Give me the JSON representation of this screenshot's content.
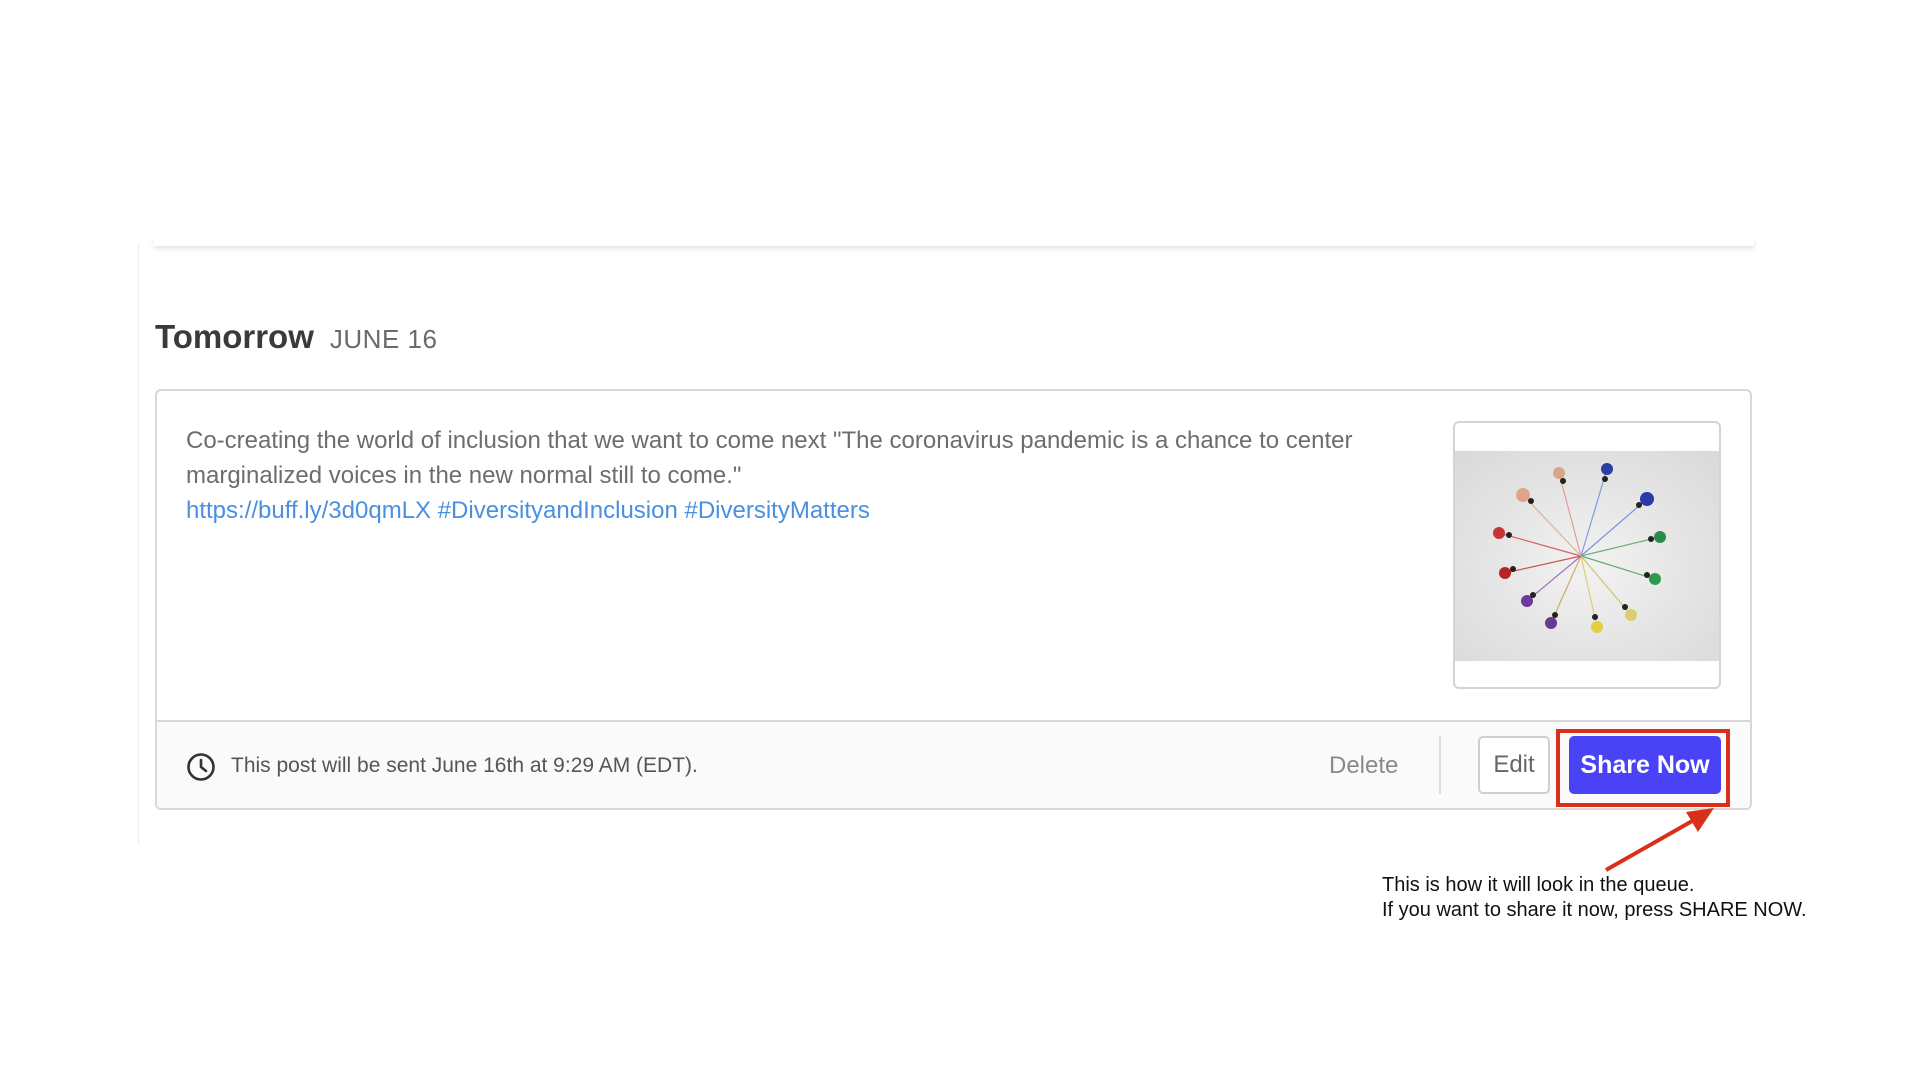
{
  "section": {
    "day_title": "Tomorrow",
    "day_date": "JUNE 16"
  },
  "post": {
    "text": "Co-creating the world of inclusion that we want to come next \"The coronavirus pandemic is a chance to center marginalized voices in the new normal still to come.\"",
    "link": "https://buff.ly/3d0qmLX #DiversityandInclusion #DiversityMatters",
    "image_icon": "people-circle-image",
    "schedule_text": "This post will be sent June 16th at 9:29 AM (EDT).",
    "schedule_icon": "clock-icon"
  },
  "actions": {
    "delete_label": "Delete",
    "edit_label": "Edit",
    "share_now_label": "Share Now"
  },
  "annotation": {
    "line1": "This is how it will look in the queue.",
    "line2": "If you want to share it now, press SHARE NOW."
  },
  "colors": {
    "share_button": "#4a42f5",
    "link": "#4a8fe0",
    "highlight": "#d9301c"
  }
}
